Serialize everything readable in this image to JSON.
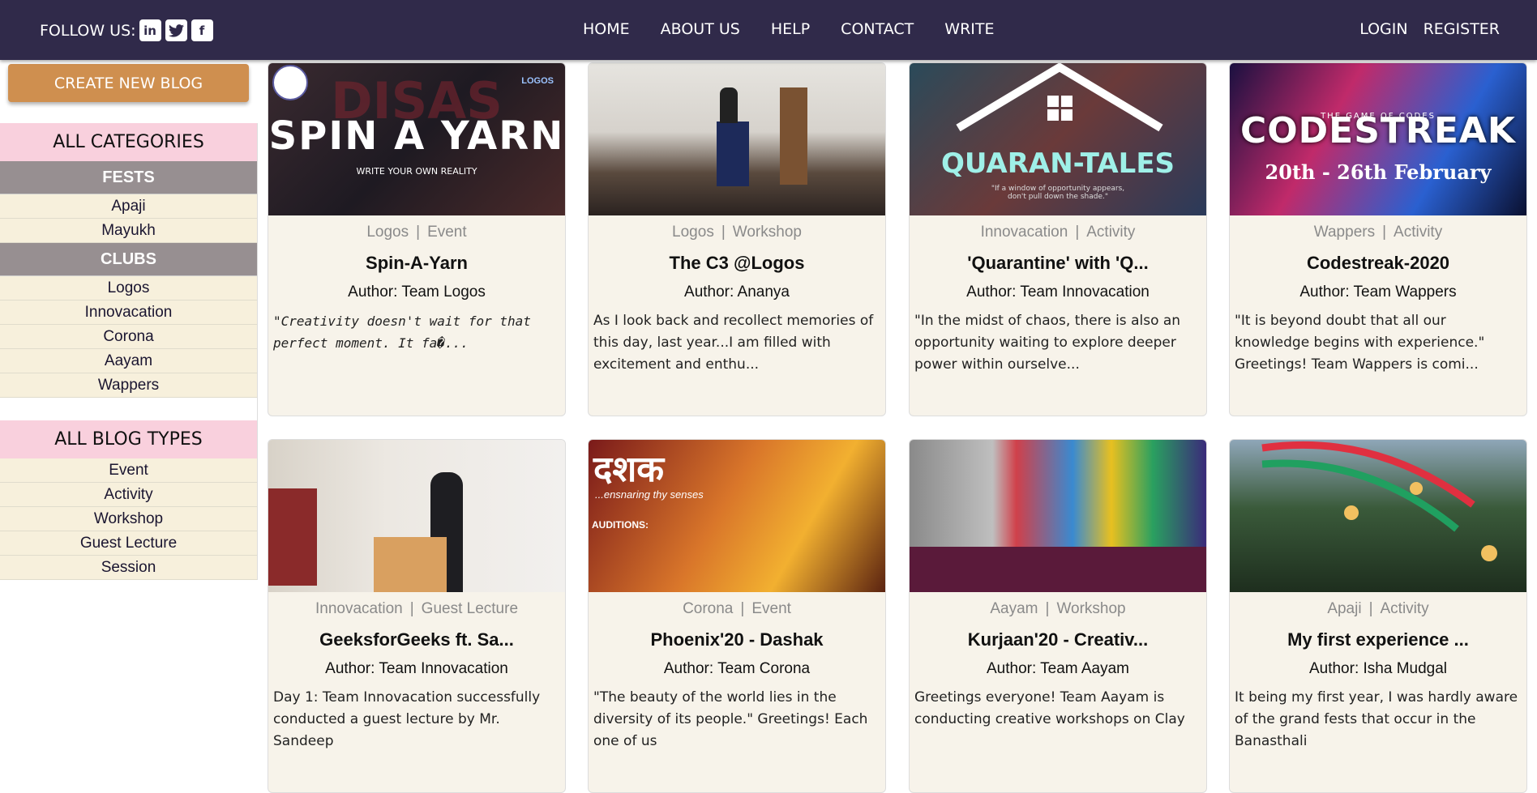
{
  "nav": {
    "follow_label": "FOLLOW US:",
    "social_icons": [
      "linkedin-icon",
      "twitter-icon",
      "facebook-icon"
    ],
    "links": [
      "HOME",
      "ABOUT US",
      "HELP",
      "CONTACT",
      "WRITE"
    ],
    "login": "LOGIN",
    "register": "REGISTER"
  },
  "sidebar": {
    "create_button": "CREATE NEW BLOG",
    "categories_title": "ALL CATEGORIES",
    "fests_title": "FESTS",
    "fests": [
      "Apaji",
      "Mayukh"
    ],
    "clubs_title": "CLUBS",
    "clubs": [
      "Logos",
      "Innovacation",
      "Corona",
      "Aayam",
      "Wappers"
    ],
    "blog_types_title": "ALL BLOG TYPES",
    "blog_types": [
      "Event",
      "Activity",
      "Workshop",
      "Guest Lecture",
      "Session"
    ]
  },
  "cards": [
    {
      "club": "Logos",
      "type": "Event",
      "title": "Spin-A-Yarn",
      "author": "Author: Team Logos",
      "excerpt": "\"Creativity doesn't wait for that perfect moment. It fa�...",
      "image_text": "SPIN A YARN",
      "image_sub": "WRITE YOUR OWN REALITY",
      "image_corner": "LOGOS"
    },
    {
      "club": "Logos",
      "type": "Workshop",
      "title": "The C3 @Logos",
      "author": "Author: Ananya",
      "excerpt": "As I look back and recollect memories of this day, last year...I am filled with excitement and enthu...",
      "image_text": "",
      "image_sub": "",
      "image_corner": ""
    },
    {
      "club": "Innovacation",
      "type": "Activity",
      "title": "'Quarantine' with 'Q...",
      "author": "Author: Team Innovacation",
      "excerpt": "\"In the midst of chaos, there is also an opportunity waiting to explore deeper power within ourselve...",
      "image_text": "QUARAN-TALES",
      "image_sub": "\"If a window of opportunity appears, don't pull down the shade.\"",
      "image_corner": ""
    },
    {
      "club": "Wappers",
      "type": "Activity",
      "title": "Codestreak-2020",
      "author": "Author: Team Wappers",
      "excerpt": "\"It is beyond doubt that all our knowledge begins with experience.\" Greetings! Team Wappers is comi...",
      "image_text": "CODESTREAK",
      "image_sub": "20th - 26th February",
      "image_corner": "THE GAME OF CODES"
    },
    {
      "club": "Innovacation",
      "type": "Guest Lecture",
      "title": "GeeksforGeeks ft. Sa...",
      "author": "Author: Team Innovacation",
      "excerpt": "Day 1: Team Innovacation successfully conducted a guest lecture by Mr. Sandeep",
      "image_text": "",
      "image_sub": "",
      "image_corner": ""
    },
    {
      "club": "Corona",
      "type": "Event",
      "title": "Phoenix'20 - Dashak",
      "author": "Author: Team Corona",
      "excerpt": "\"The beauty of the world lies in the diversity of its people.\" Greetings! Each one of us",
      "image_text": "दशक",
      "image_sub": "...ensnaring thy senses",
      "image_corner": "AUDITIONS:"
    },
    {
      "club": "Aayam",
      "type": "Workshop",
      "title": "Kurjaan'20 - Creativ...",
      "author": "Author: Team Aayam",
      "excerpt": "Greetings everyone! Team Aayam is conducting creative workshops on Clay",
      "image_text": "",
      "image_sub": "",
      "image_corner": ""
    },
    {
      "club": "Apaji",
      "type": "Activity",
      "title": "My first experience ...",
      "author": "Author: Isha Mudgal",
      "excerpt": "It being my first year, I was hardly aware of the grand fests that occur in the Banasthali",
      "image_text": "",
      "image_sub": "",
      "image_corner": ""
    }
  ],
  "colors": {
    "navbar": "#302a4a",
    "create_button": "#cf8f4f",
    "category_header": "#f9d0dd",
    "group_header": "#978f91",
    "item_bg": "#f7f0dc",
    "card_bg": "#f7f3ea"
  }
}
